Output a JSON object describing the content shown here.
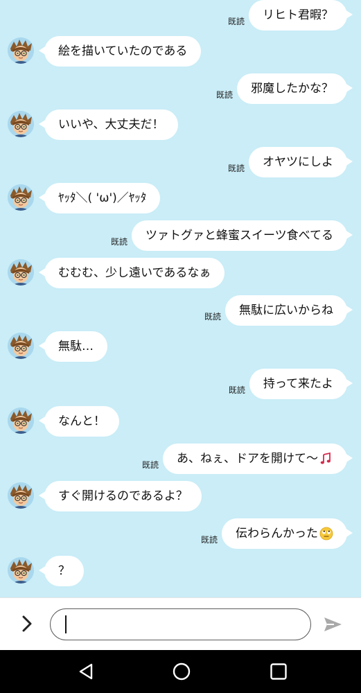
{
  "read_label": "既読",
  "messages": [
    {
      "side": "sent",
      "text": "リヒト君暇？",
      "read": true
    },
    {
      "side": "recv",
      "text": "絵を描いていたのである"
    },
    {
      "side": "sent",
      "text": "邪魔したかな？",
      "read": true
    },
    {
      "side": "recv",
      "text": "いいや、大丈夫だ！"
    },
    {
      "side": "sent",
      "text": "オヤツにしよ",
      "read": true
    },
    {
      "side": "recv",
      "text": "ﾔｯﾀ＼( 'ω')／ﾔｯﾀ"
    },
    {
      "side": "sent",
      "text": "ツァトグァと蜂蜜スイーツ食べてる",
      "read": true
    },
    {
      "side": "recv",
      "text": "むむむ、少し遠いであるなぁ"
    },
    {
      "side": "sent",
      "text": "無駄に広いからね",
      "read": true
    },
    {
      "side": "recv",
      "text": "無駄…"
    },
    {
      "side": "sent",
      "text": "持って来たよ",
      "read": true
    },
    {
      "side": "recv",
      "text": "なんと！"
    },
    {
      "side": "sent",
      "text": "あ、ねぇ、ドアを開けて〜",
      "read": true,
      "emoji": "music-notes"
    },
    {
      "side": "recv",
      "text": "すぐ開けるのであるよ？"
    },
    {
      "side": "sent",
      "text": "伝わらんかった",
      "read": true,
      "emoji": "eye-roll-face"
    },
    {
      "side": "recv",
      "text": "？"
    }
  ],
  "input": {
    "value": "",
    "placeholder": ""
  },
  "icons": {
    "expand": "chevron-right-icon",
    "send": "send-icon",
    "nav_back": "back-triangle-icon",
    "nav_home": "home-circle-icon",
    "nav_recents": "recents-square-icon"
  },
  "colors": {
    "chat_background": "#caedf7",
    "bubble": "#ffffff",
    "nav_bar": "#000000"
  }
}
